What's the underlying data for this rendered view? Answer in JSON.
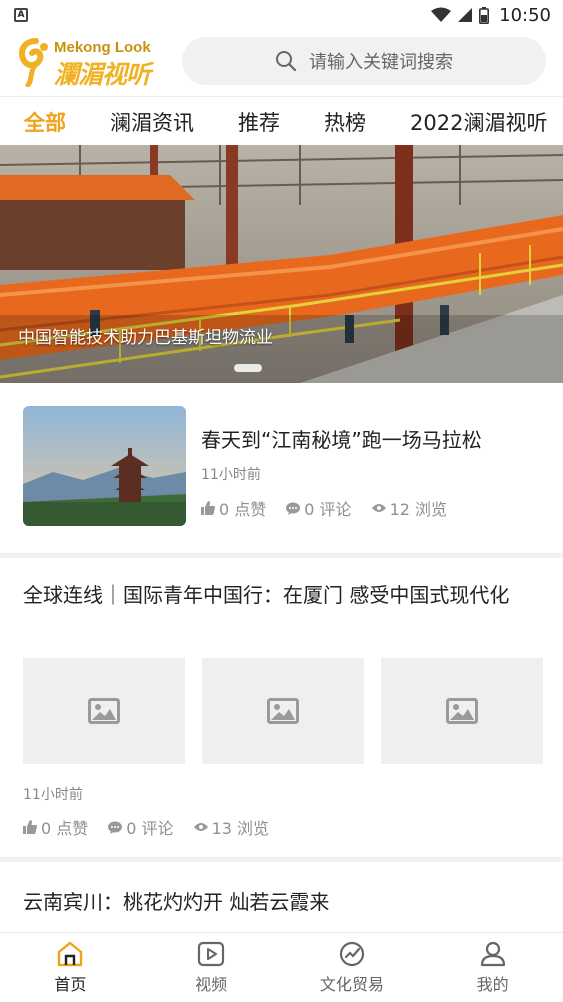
{
  "status_bar": {
    "time": "10:50",
    "notif_letter": "A"
  },
  "header": {
    "logo_en": "Mekong Look",
    "logo_cn": "瀾湄视听",
    "search_placeholder": "请输入关键词搜索"
  },
  "tabs": [
    {
      "label": "全部",
      "active": true
    },
    {
      "label": "澜湄资讯"
    },
    {
      "label": "推荐"
    },
    {
      "label": "热榜"
    },
    {
      "label": "2022澜湄视听"
    }
  ],
  "banner": {
    "caption": "中国智能技术助力巴基斯坦物流业"
  },
  "articles": [
    {
      "title": "春天到“江南秘境”跑一场马拉松",
      "time": "11小时前",
      "likes": "0 点赞",
      "comments": "0 评论",
      "views": "12 浏览"
    },
    {
      "title": "全球连线｜国际青年中国行：在厦门 感受中国式现代化",
      "time": "11小时前",
      "likes": "0 点赞",
      "comments": "0 评论",
      "views": "13 浏览"
    },
    {
      "title": "云南宾川：桃花灼灼开 灿若云霞来"
    }
  ],
  "bottom_nav": [
    {
      "label": "首页",
      "icon": "home-icon",
      "active": true
    },
    {
      "label": "视频",
      "icon": "video-icon"
    },
    {
      "label": "文化贸易",
      "icon": "trade-icon"
    },
    {
      "label": "我的",
      "icon": "profile-icon"
    }
  ],
  "colors": {
    "accent": "#f0a21b",
    "brand_orange": "#e8691e"
  }
}
